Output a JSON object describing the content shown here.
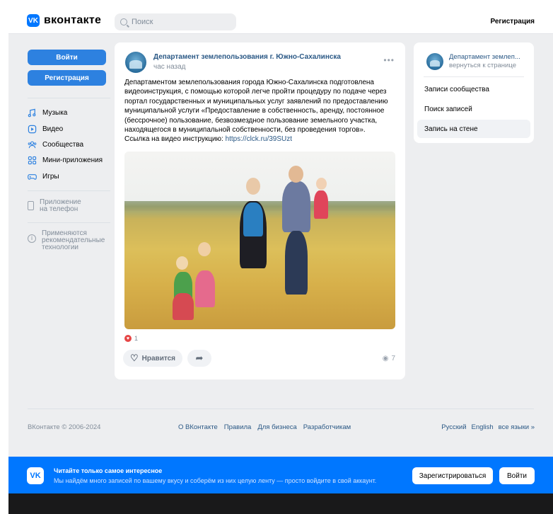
{
  "header": {
    "logo_text": "вконтакте",
    "logo_badge": "VK",
    "search_placeholder": "Поиск",
    "register_link": "Регистрация"
  },
  "sidebar": {
    "login_button": "Войти",
    "register_button": "Регистрация",
    "items": [
      {
        "label": "Музыка",
        "icon": "music-icon"
      },
      {
        "label": "Видео",
        "icon": "video-icon"
      },
      {
        "label": "Сообщества",
        "icon": "groups-icon"
      },
      {
        "label": "Мини-приложения",
        "icon": "apps-icon"
      },
      {
        "label": "Игры",
        "icon": "games-icon"
      }
    ],
    "app_line1": "Приложение",
    "app_line2": "на телефон",
    "rec_line1": "Применяются",
    "rec_line2": "рекомендательные",
    "rec_line3": "технологии"
  },
  "post": {
    "author": "Департамент землепользования г. Южно-Сахалинска",
    "time": "час назад",
    "more": "•••",
    "text": "Департаментом землепользования города Южно-Сахалинска подготовлена видеоинструкция, с помощью которой легче пройти процедуру по подаче через портал государственных и муниципальных услуг заявлений по предоставлению муниципальной услуги «Предоставление в собственность, аренду, постоянное (бессрочное) пользование, безвозмездное пользование земельного участка, находящегося в муниципальной собственности, без проведения торгов».",
    "link_prefix": "Ссылка на видео инструкцию: ",
    "link": "https://clck.ru/39SUzt",
    "likes_count": "1",
    "like_label": "Нравится",
    "views": "7"
  },
  "right": {
    "name": "Департамент землеп...",
    "back": "вернуться к странице",
    "items": [
      "Записи сообщества",
      "Поиск записей",
      "Запись на стене"
    ]
  },
  "footer": {
    "copyright": "ВКонтакте © 2006-2024",
    "links": [
      "О ВКонтакте",
      "Правила",
      "Для бизнеса",
      "Разработчикам"
    ],
    "langs": [
      "Русский",
      "English",
      "все языки »"
    ]
  },
  "banner": {
    "title": "Читайте только самое интересное",
    "subtitle": "Мы найдём много записей по вашему вкусу и соберём из них целую ленту — просто войдите в свой аккаунт.",
    "register_button": "Зарегистрироваться",
    "login_button": "Войти"
  },
  "colors": {
    "accent": "#0077ff",
    "button": "#2d81e0",
    "link": "#2a5885",
    "background": "#edeef0"
  }
}
